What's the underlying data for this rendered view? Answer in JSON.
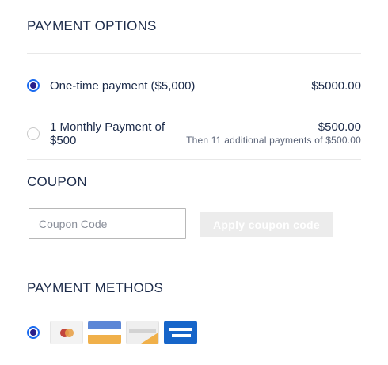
{
  "payment_options": {
    "title": "PAYMENT OPTIONS",
    "options": [
      {
        "label": "One-time payment ($5,000)",
        "price": "$5000.00",
        "note": "",
        "selected": true
      },
      {
        "label": "1 Monthly Payment of $500",
        "price": "$500.00",
        "note": "Then 11 additional payments of $500.00",
        "selected": false
      }
    ]
  },
  "coupon": {
    "title": "COUPON",
    "placeholder": "Coupon Code",
    "value": "",
    "apply_label": "Apply coupon code"
  },
  "payment_methods": {
    "title": "PAYMENT METHODS",
    "selected": true,
    "cards": [
      {
        "icon": "mastercard-icon"
      },
      {
        "icon": "visa-card-icon"
      },
      {
        "icon": "amex-card-icon"
      },
      {
        "icon": "bank-card-icon"
      }
    ]
  },
  "colors": {
    "accent": "#1a6bf0",
    "radio_dot": "#2a1f8a",
    "text": "#1c2b4a",
    "disabled_button": "#ececec"
  }
}
